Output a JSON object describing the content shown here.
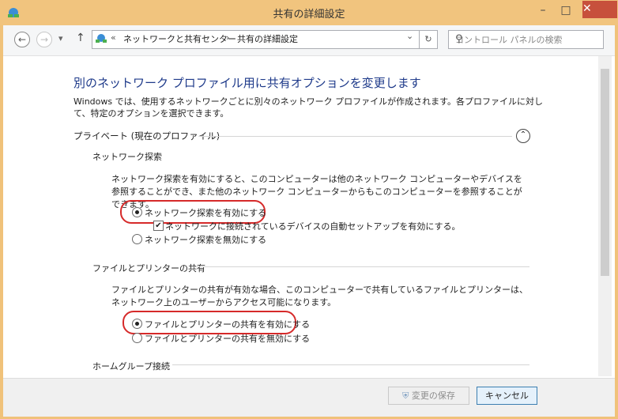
{
  "window": {
    "title": "共有の詳細設定",
    "minimize": "–",
    "maximize": "□",
    "close": "✕"
  },
  "nav": {
    "back": "←",
    "forward": "→",
    "dropdown": "▾",
    "up": "↑",
    "breadcrumb_chevrons": "«",
    "crumb1": "ネットワークと共有センター",
    "crumb_sep": "›",
    "crumb2": "共有の詳細設定",
    "addr_dropdown": "⌄",
    "refresh": "↻",
    "search_placeholder": "コントロール パネルの検索",
    "search_icon": "⚲"
  },
  "main": {
    "heading": "別のネットワーク プロファイル用に共有オプションを変更します",
    "description": "Windows では、使用するネットワークごとに別々のネットワーク プロファイルが作成されます。各プロファイルに対して、特定のオプションを選択できます。",
    "profile_label": "プライベート (現在のプロファイル)",
    "collapse_icon": "⌃",
    "sections": {
      "discovery": {
        "title": "ネットワーク探索",
        "text": "ネットワーク探索を有効にすると、このコンピューターは他のネットワーク コンピューターやデバイスを参照することができ、また他のネットワーク コンピューターからもこのコンピューターを参照することができます。",
        "opt_on": "ネットワーク探索を有効にする",
        "opt_auto": "ネットワークに接続されているデバイスの自動セットアップを有効にする。",
        "opt_off": "ネットワーク探索を無効にする",
        "check_mark": "✔"
      },
      "sharing": {
        "title": "ファイルとプリンターの共有",
        "text": "ファイルとプリンターの共有が有効な場合、このコンピューターで共有しているファイルとプリンターは、ネットワーク上のユーザーからアクセス可能になります。",
        "opt_on": "ファイルとプリンターの共有を有効にする",
        "opt_off": "ファイルとプリンターの共有を無効にする"
      },
      "homegroup": {
        "title": "ホームグループ接続"
      }
    }
  },
  "footer": {
    "save": "変更の保存",
    "cancel": "キャンセル",
    "shield_icon": "⛨"
  }
}
